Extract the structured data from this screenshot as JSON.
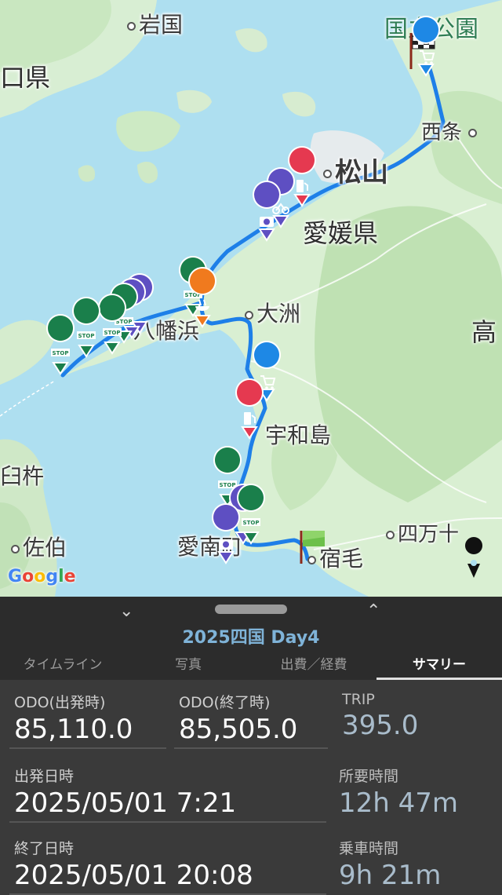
{
  "map": {
    "places": {
      "iwakuni": "岩国",
      "kokuritsu_koen": "国立公園",
      "yamaguchi_ken": "口県",
      "saijo": "西条",
      "matsuyama": "松山",
      "ehime_ken": "愛媛県",
      "ozu": "大洲",
      "yawatahama": "八幡浜",
      "kochi": "高",
      "uwajima": "宇和島",
      "usuki": "臼杵",
      "saiki": "佐伯",
      "shimanto": "四万十",
      "ainan": "愛南町",
      "sukumo": "宿毛"
    },
    "stop_label": "STOP",
    "attribution": "Google",
    "markers": [
      {
        "type": "shop",
        "icon": "cart-icon",
        "color": "#1e88e5"
      },
      {
        "type": "fuel",
        "icon": "fuel-pump-icon",
        "color": "#e53950"
      },
      {
        "type": "photo",
        "icon": "camera-icon",
        "color": "#5e4fc2"
      },
      {
        "type": "stop",
        "icon": "stop-sign-icon",
        "color": "#1a7f4b"
      },
      {
        "type": "food",
        "icon": "ramen-icon",
        "color": "#f07a1e"
      },
      {
        "type": "flag",
        "icon": "goal-flag-icon",
        "color": "#6cc04a"
      }
    ]
  },
  "sheet": {
    "title": "2025四国 Day4",
    "tabs": [
      "タイムライン",
      "写真",
      "出費／経費",
      "サマリー"
    ],
    "active_tab": "サマリー"
  },
  "summary": {
    "odo_start_label": "ODO(出発時)",
    "odo_start": "85,110.0",
    "odo_end_label": "ODO(終了時)",
    "odo_end": "85,505.0",
    "trip_label": "TRIP",
    "trip": "395.0",
    "start_dt_label": "出発日時",
    "start_dt": "2025/05/01 7:21",
    "duration_label": "所要時間",
    "duration": "12h 47m",
    "end_dt_label": "終了日時",
    "end_dt": "2025/05/01 20:08",
    "ride_label": "乗車時間",
    "ride": "9h 21m"
  }
}
